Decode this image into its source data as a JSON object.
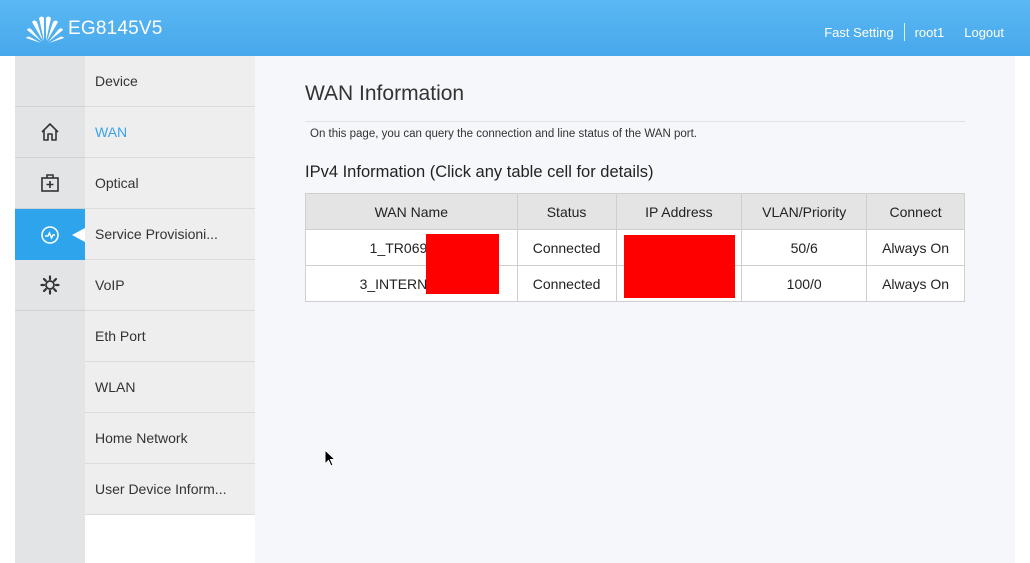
{
  "header": {
    "model": "EG8145V5",
    "fast_setting": "Fast Setting",
    "user": "root1",
    "logout": "Logout"
  },
  "colors": {
    "header_blue": "#4aabee",
    "active_blue": "#2ea4ec",
    "redaction": "#ff0000"
  },
  "rail": {
    "icons": [
      "home-icon",
      "medical-kit-icon",
      "diagnosis-icon",
      "gear-icon"
    ],
    "active": "diagnosis-icon"
  },
  "menu": {
    "items": [
      {
        "label": "Device"
      },
      {
        "label": "WAN"
      },
      {
        "label": "Optical"
      },
      {
        "label": "Service Provisioni..."
      },
      {
        "label": "VoIP"
      },
      {
        "label": "Eth Port"
      },
      {
        "label": "WLAN"
      },
      {
        "label": "Home Network"
      },
      {
        "label": "User Device Inform..."
      }
    ],
    "active": "WAN"
  },
  "main": {
    "title": "WAN Information",
    "description": "On this page, you can query the connection and line status of the WAN port.",
    "section_title": "IPv4 Information (Click any table cell for details)",
    "table": {
      "headers": [
        "WAN Name",
        "Status",
        "IP Address",
        "VLAN/Priority",
        "Connect"
      ],
      "rows": [
        {
          "name": "1_TR069_R_",
          "status": "Connected",
          "ip": "",
          "vlan": "50/6",
          "connect": "Always On"
        },
        {
          "name": "3_INTERNET_R",
          "status": "Connected",
          "ip": "",
          "vlan": "100/0",
          "connect": "Always On"
        }
      ]
    }
  }
}
